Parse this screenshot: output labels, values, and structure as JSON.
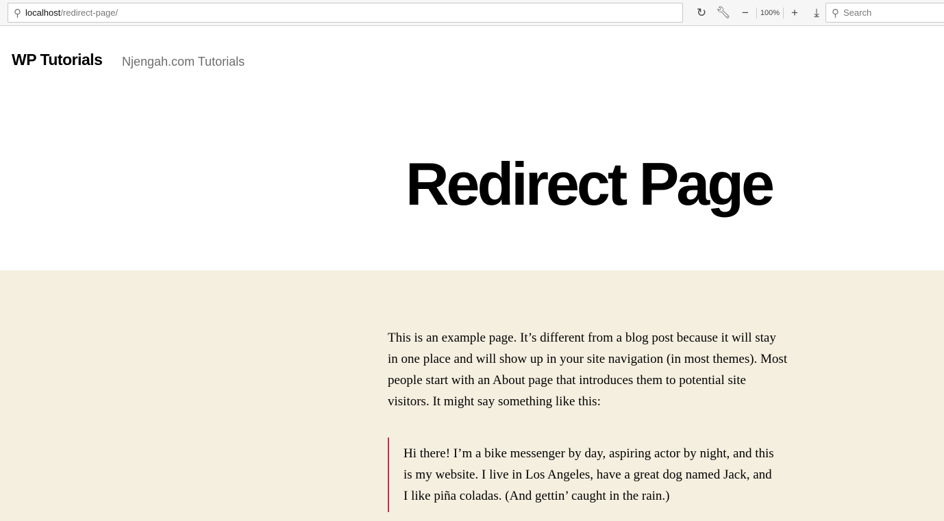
{
  "browser": {
    "url_host": "localhost",
    "url_path": "/redirect-page/",
    "zoom": "100%",
    "search_placeholder": "Search",
    "icons": {
      "search": "magnifier-icon",
      "reload": "reload-icon",
      "tools": "wrench-icon",
      "zoom_out": "minus-icon",
      "zoom_in": "plus-icon",
      "download": "download-icon"
    }
  },
  "header": {
    "site_title": "WP Tutorials",
    "tagline": "Njengah.com Tutorials"
  },
  "page": {
    "title": "Redirect Page",
    "paragraph": "This is an example page. It’s different from a blog post because it will stay in one place and will show up in your site navigation (in most themes). Most people start with an About page that introduces them to potential site visitors. It might say something like this:",
    "quote": "Hi there! I’m a bike messenger by day, aspiring actor by night, and this is my website. I live in Los Angeles, have a great dog named Jack, and I like piña coladas. (And gettin’ caught in the rain.)"
  },
  "colors": {
    "content_bg": "#f5efe0",
    "quote_border": "#cd2653"
  }
}
